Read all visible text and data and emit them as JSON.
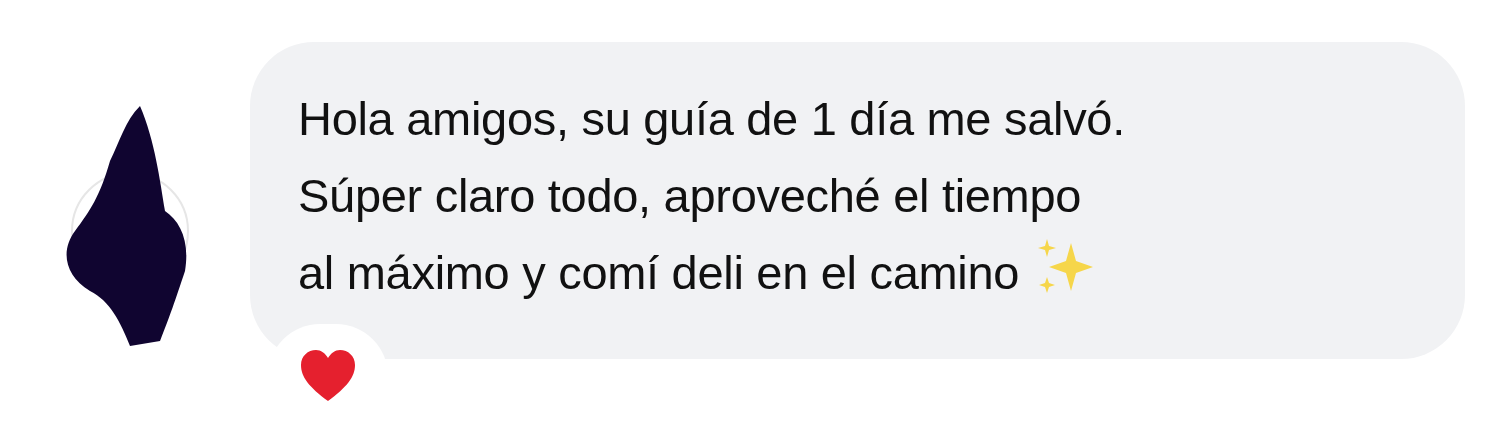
{
  "message": {
    "text": "Hola amigos, su guía de 1 día me salvó.\nSúper claro todo, aproveché el tiempo\nal máximo y comí deli en el camino"
  }
}
